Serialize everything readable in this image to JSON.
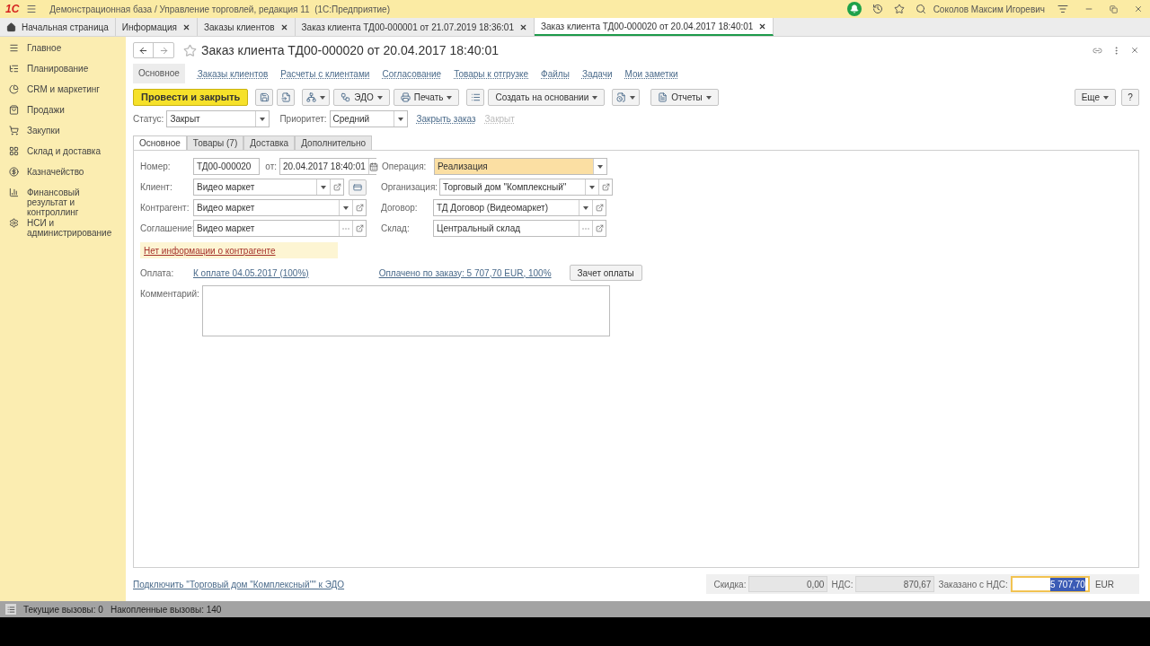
{
  "app": {
    "logo": "1С",
    "title": "Демонстрационная база / Управление торговлей, редакция 11  (1С:Предприятие)",
    "user": "Соколов Максим Игоревич"
  },
  "open_tabs": [
    {
      "kind": "home",
      "label": "Начальная страница",
      "selected": false
    },
    {
      "kind": "tab",
      "label": "Информация",
      "selected": false
    },
    {
      "kind": "tab",
      "label": "Заказы клиентов",
      "selected": false
    },
    {
      "kind": "tab",
      "label": "Заказ клиента ТД00-000001 от 21.07.2019 18:36:01",
      "selected": false
    },
    {
      "kind": "tab",
      "label": "Заказ клиента ТД00-000020 от 20.04.2017 18:40:01",
      "selected": true
    }
  ],
  "sidebar": {
    "items": [
      {
        "label": "Главное"
      },
      {
        "label": "Планирование"
      },
      {
        "label": "CRM и маркетинг"
      },
      {
        "label": "Продажи"
      },
      {
        "label": "Закупки"
      },
      {
        "label": "Склад и доставка"
      },
      {
        "label": "Казначейство"
      },
      {
        "label": "Финансовый результат и контроллинг"
      },
      {
        "label": "НСИ и администрирование"
      }
    ]
  },
  "form": {
    "title": "Заказ клиента ТД00-000020 от 20.04.2017 18:40:01",
    "nav": [
      {
        "label": "Основное",
        "selected": true
      },
      {
        "label": "Заказы клиентов",
        "selected": false
      },
      {
        "label": "Расчеты с клиентами",
        "selected": false
      },
      {
        "label": "Согласование",
        "selected": false
      },
      {
        "label": "Товары к отгрузке",
        "selected": false
      },
      {
        "label": "Файлы",
        "selected": false
      },
      {
        "label": "Задачи",
        "selected": false
      },
      {
        "label": "Мои заметки",
        "selected": false
      }
    ],
    "toolbar": [
      {
        "kind": "primary",
        "label": "Провести и закрыть"
      },
      {
        "kind": "icon"
      },
      {
        "kind": "icon"
      },
      {
        "kind": "icon_menu"
      },
      {
        "kind": "menu",
        "label": "ЭДО"
      },
      {
        "kind": "menu",
        "label": "Печать"
      },
      {
        "kind": "icon"
      },
      {
        "kind": "menu",
        "label": "Создать на основании"
      },
      {
        "kind": "icon_menu"
      },
      {
        "kind": "menu",
        "label": "Отчеты"
      }
    ],
    "toolbar_right": [
      {
        "kind": "menu",
        "label": "Еще"
      },
      {
        "kind": "plain",
        "label": "?"
      }
    ],
    "status": {
      "label": "Статус:",
      "value": "Закрыт"
    },
    "priority": {
      "label": "Приоритет:",
      "value": "Средний"
    },
    "status_links": [
      {
        "label": "Закрыть заказ",
        "disabled": false
      },
      {
        "label": "Закрыт",
        "disabled": true
      }
    ],
    "tabs": [
      {
        "label": "Основное",
        "selected": true
      },
      {
        "label": "Товары (7)",
        "selected": false
      },
      {
        "label": "Доставка",
        "selected": false
      },
      {
        "label": "Дополнительно",
        "selected": false
      }
    ],
    "number": {
      "label": "Номер:",
      "value": "ТД00-000020"
    },
    "date": {
      "label": "от:",
      "value": "20.04.2017 18:40:01"
    },
    "left_fields": [
      {
        "label": "Клиент:",
        "value": "Видео маркет",
        "kind": "choice",
        "extra_button": true
      },
      {
        "label": "Контрагент:",
        "value": "Видео маркет",
        "kind": "choice",
        "extra_button": false
      },
      {
        "label": "Соглашение:",
        "value": "Видео маркет",
        "kind": "reference",
        "extra_button": false
      }
    ],
    "right_fields": [
      {
        "label": "Операция:",
        "value": "Реализация",
        "kind": "list",
        "highlighted": true
      },
      {
        "label": "Организация:",
        "value": "Торговый дом \"Комплексный\"",
        "kind": "choice",
        "highlighted": false
      },
      {
        "label": "Договор:",
        "value": "ТД Договор (Видеомаркет)",
        "kind": "choice",
        "highlighted": false
      },
      {
        "label": "Склад:",
        "value": "Центральный склад",
        "kind": "reference",
        "highlighted": false
      }
    ],
    "warning": "Нет информации о контрагенте",
    "payment": {
      "label": "Оплата:",
      "due_link": "К оплате 04.05.2017 (100%)",
      "paid_link": "Оплачено по заказу: 5 707,70 EUR, 100%",
      "button": "Зачет оплаты"
    },
    "comment": {
      "label": "Комментарий:"
    },
    "footer": {
      "link": "Подключить \"Торговый дом \"Комплексный\"\" к ЭДО",
      "totals": [
        {
          "label": "Скидка:",
          "value": "0,00",
          "focused": false
        },
        {
          "label": "НДС:",
          "value": "870,67",
          "focused": false
        },
        {
          "label": "Заказано с НДС:",
          "value": "5 707,70",
          "focused": true
        }
      ],
      "currency": "EUR"
    }
  },
  "status_bar": [
    "Текущие вызовы: 0",
    "Накопленные вызовы: 140"
  ]
}
